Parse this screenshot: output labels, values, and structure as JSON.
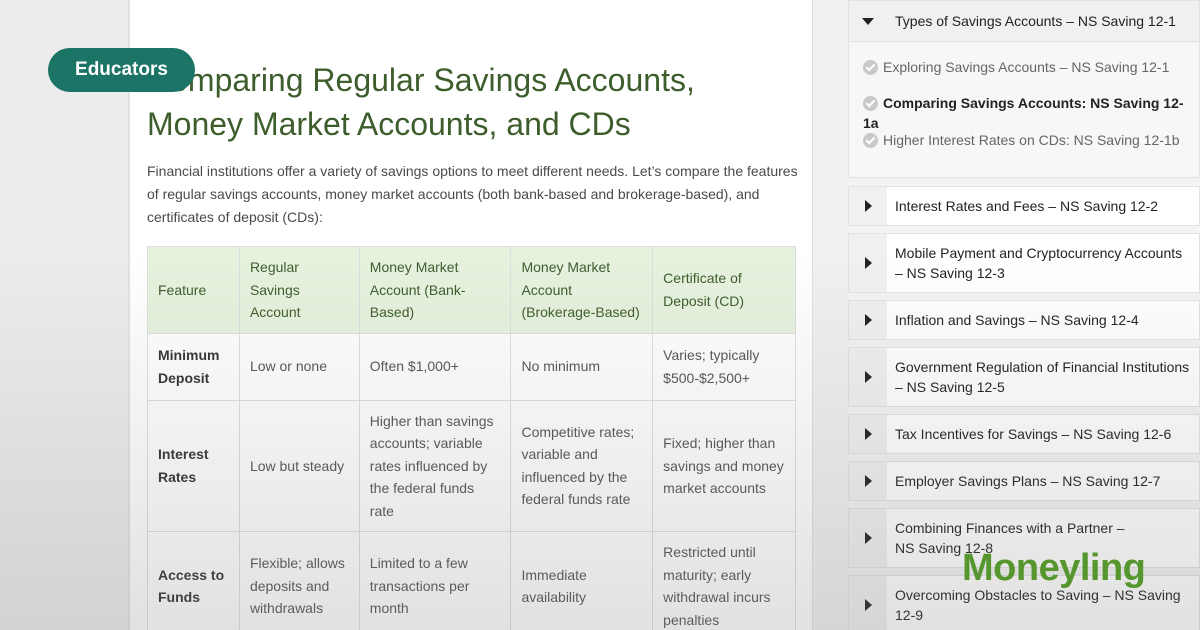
{
  "badge": "Educators",
  "brand": "Moneyling",
  "article": {
    "title": "Comparing Regular Savings Accounts, Money Market Accounts, and CDs",
    "intro": "Financial institutions offer a variety of savings options to meet different needs. Let’s compare the features of regular savings accounts, money market accounts (both bank-based and brokerage-based), and certificates of deposit (CDs):",
    "table": {
      "headers": [
        "Feature",
        "Regular Savings Account",
        "Money Market Account (Bank-Based)",
        "Money Market Account (Brokerage-Based)",
        "Certificate of Deposit (CD)"
      ],
      "rows": [
        [
          "Minimum Deposit",
          "Low or none",
          "Often $1,000+",
          "No minimum",
          "Varies; typically $500-$2,500+"
        ],
        [
          "Interest Rates",
          "Low but steady",
          "Higher than savings accounts; variable rates influenced by the federal funds rate",
          "Competitive rates; variable and influenced by the federal funds rate",
          "Fixed; higher than savings and money market accounts"
        ],
        [
          "Access to Funds",
          "Flexible; allows deposits and withdrawals",
          "Limited to a few transactions per month",
          "Immediate availability",
          "Restricted until maturity; early withdrawal incurs penalties"
        ]
      ]
    }
  },
  "sidebar": {
    "open_section": {
      "title": "Types of Savings Accounts – NS Saving 12-1",
      "lessons": [
        {
          "label": "Exploring Savings Accounts – NS Saving 12-1"
        },
        {
          "label": "Comparing Savings Accounts: NS Saving 12-1a"
        },
        {
          "label": "Higher Interest Rates on CDs: NS Saving 12-1b"
        }
      ]
    },
    "sections": [
      {
        "label": "Interest Rates and Fees – NS Saving 12-2"
      },
      {
        "label": "Mobile Payment and Cryptocurrency Accounts – NS Saving 12-3"
      },
      {
        "label": "Inflation and Savings – NS Saving 12-4"
      },
      {
        "label": "Government Regulation of Financial Institutions – NS Saving 12-5"
      },
      {
        "label": "Tax Incentives for Savings – NS Saving 12-6"
      },
      {
        "label": "Employer Savings Plans – NS Saving 12-7"
      },
      {
        "label": "Combining Finances with a Partner – NS Saving 12-8"
      },
      {
        "label": "Overcoming Obstacles to Saving – NS Saving 12-9"
      }
    ]
  }
}
